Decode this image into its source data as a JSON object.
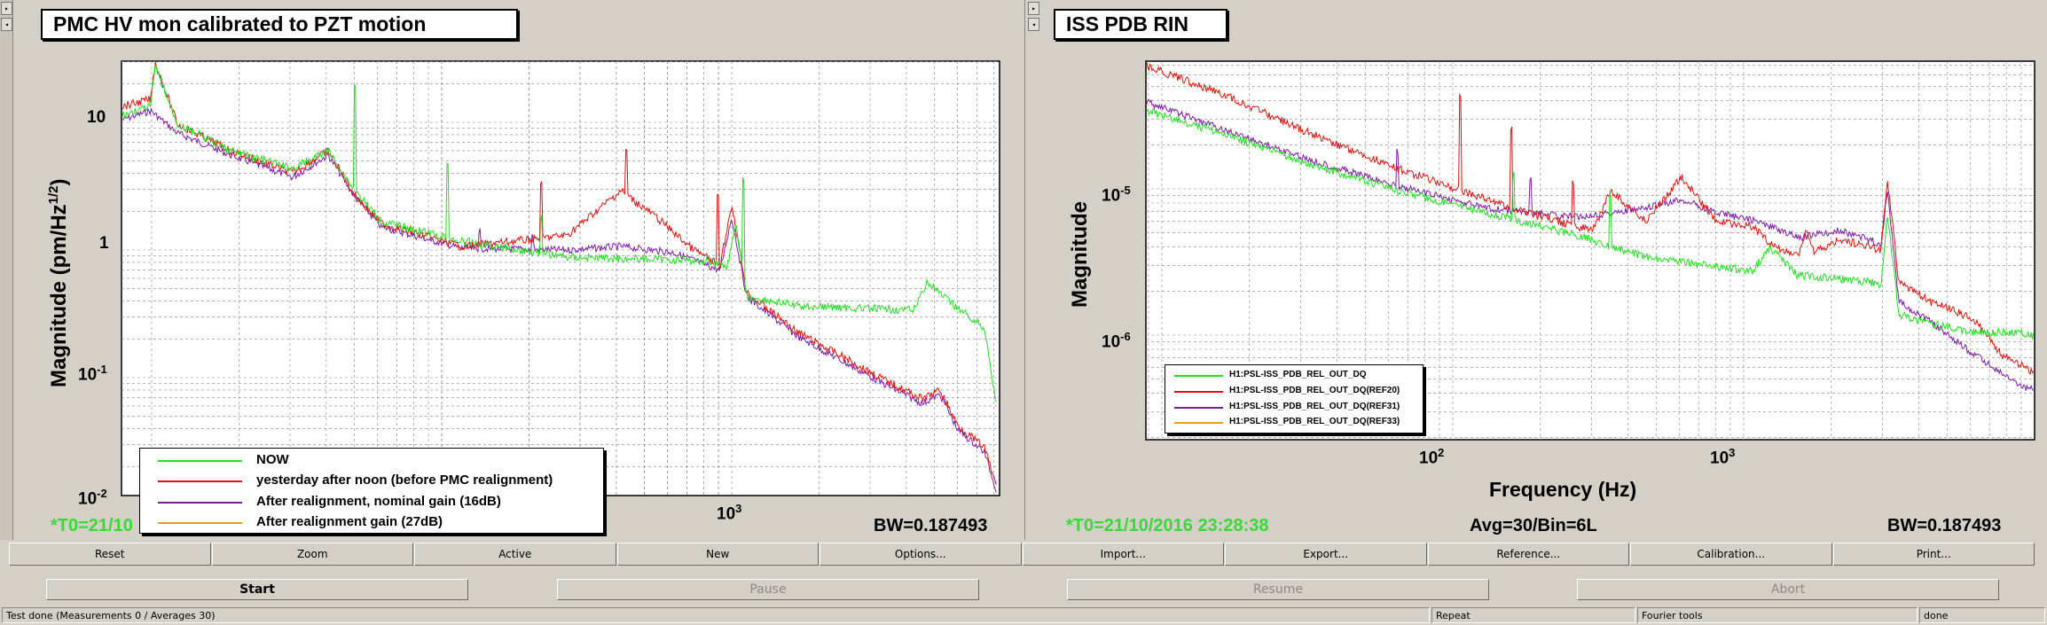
{
  "left_panel": {
    "title": "PMC HV mon calibrated to PZT motion",
    "ylabel": "Magnitude (pm/Hz",
    "ylabel_sup": "1/2",
    "ylabel_end": ")",
    "t0": "*T0=21/10",
    "bw": "BW=0.187493",
    "y_ticks": [
      "10",
      "1",
      "10",
      "10"
    ],
    "y_tick_exps": [
      "",
      "",
      "-1",
      "-2"
    ],
    "x_ticks": [
      "10"
    ],
    "x_tick_exps": [
      "3"
    ],
    "legend": [
      {
        "label": "NOW",
        "color": "#22dd22"
      },
      {
        "label": "yesterday after noon (before PMC realignment)",
        "color": "#dd1111"
      },
      {
        "label": "After realignment, nominal gain (16dB)",
        "color": "#7a1ea0"
      },
      {
        "label": " After realignment gain (27dB)",
        "color": "#e8a020"
      }
    ]
  },
  "right_panel": {
    "title": "ISS PDB RIN",
    "ylabel": "Magnitude",
    "xlabel": "Frequency (Hz)",
    "t0": "*T0=21/10/2016 23:28:38",
    "avg": "Avg=30/Bin=6L",
    "bw": "BW=0.187493",
    "y_tick_base": "10",
    "y_tick_exps": [
      "-5",
      "-6"
    ],
    "x_tick_base": "10",
    "x_tick_exps": [
      "2",
      "3"
    ],
    "legend": [
      {
        "label": "H1:PSL-ISS_PDB_REL_OUT_DQ",
        "color": "#22dd22"
      },
      {
        "label": "H1:PSL-ISS_PDB_REL_OUT_DQ(REF20)",
        "color": "#dd1111"
      },
      {
        "label": "H1:PSL-ISS_PDB_REL_OUT_DQ(REF31)",
        "color": "#7a1ea0"
      },
      {
        "label": "H1:PSL-ISS_PDB_REL_OUT_DQ(REF33)",
        "color": "#e8a020"
      }
    ]
  },
  "toolbar": [
    "Reset",
    "Zoom",
    "Active",
    "New",
    "Options...",
    "Import...",
    "Export...",
    "Reference...",
    "Calibration...",
    "Print..."
  ],
  "controls": {
    "start": "Start",
    "pause": "Pause",
    "resume": "Resume",
    "abort": "Abort"
  },
  "status": {
    "message": "Test done (Measurements 0 / Averages 30)",
    "mode": "Repeat",
    "tools": "Fourier tools",
    "state": "done"
  },
  "side_arrows": [
    "▸",
    "◂"
  ]
}
